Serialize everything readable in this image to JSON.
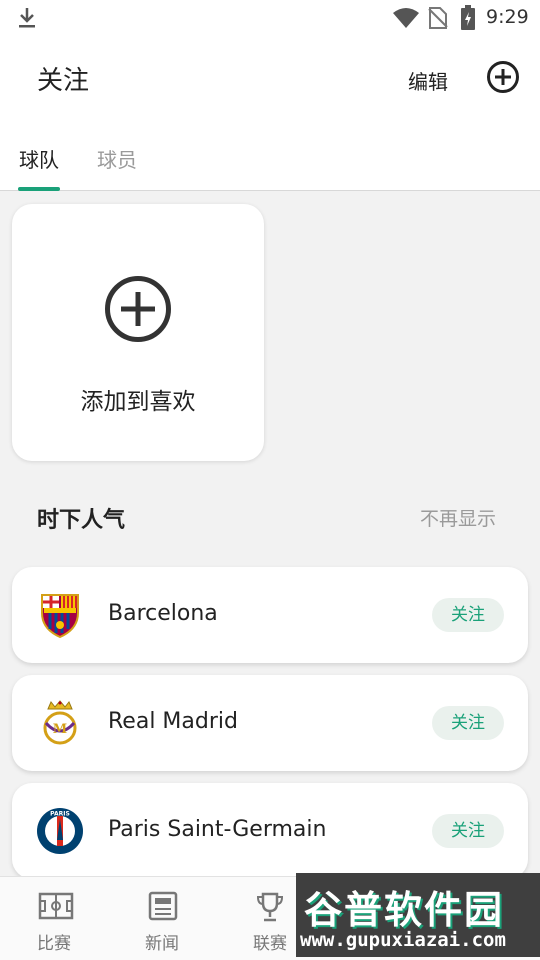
{
  "status_bar": {
    "time": "9:29"
  },
  "header": {
    "title": "关注",
    "edit_label": "编辑"
  },
  "tabs": [
    {
      "label": "球队",
      "active": true
    },
    {
      "label": "球员",
      "active": false
    }
  ],
  "add_card": {
    "label": "添加到喜欢"
  },
  "popular": {
    "title": "时下人气",
    "dismiss_label": "不再显示",
    "teams": [
      {
        "name": "Barcelona",
        "follow_label": "关注",
        "crest": "barcelona-crest"
      },
      {
        "name": "Real Madrid",
        "follow_label": "关注",
        "crest": "real-madrid-crest"
      },
      {
        "name": "Paris Saint-Germain",
        "follow_label": "关注",
        "crest": "psg-crest"
      }
    ]
  },
  "bottom_nav": [
    {
      "label": "比赛",
      "icon": "pitch-icon"
    },
    {
      "label": "新闻",
      "icon": "news-icon"
    },
    {
      "label": "联赛",
      "icon": "trophy-icon"
    }
  ],
  "watermark": {
    "brand": "谷普软件园",
    "url": "www.gupuxiazai.com"
  },
  "colors": {
    "accent": "#1aa179",
    "follow_bg": "#eaf1ed",
    "muted": "#9a9a9a",
    "background": "#f2f2f2"
  }
}
